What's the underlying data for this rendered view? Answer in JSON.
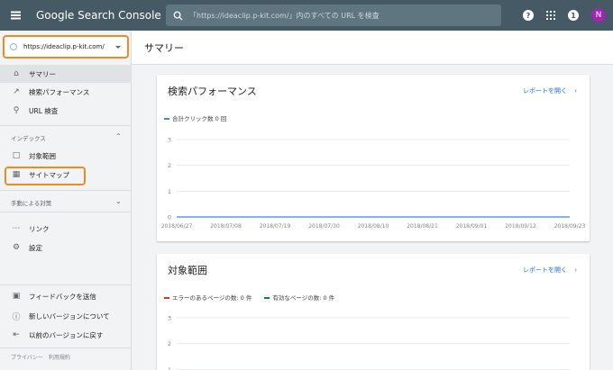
{
  "topbar": {
    "app_title": "Google Search Console",
    "search_placeholder": "「https://ideaclip.p-kit.com/」内のすべての URL を検査",
    "help_icon": "help-icon",
    "apps_icon": "apps-icon",
    "notification_count": "1",
    "avatar_letter": "N",
    "colors": {
      "bar": "#455a64",
      "avatar": "#9c27b0"
    }
  },
  "sidebar": {
    "property": "https://ideaclip.p-kit.com/",
    "items": [
      {
        "label": "サマリー",
        "icon": "home-icon"
      },
      {
        "label": "検索パフォーマンス",
        "icon": "trending-icon"
      },
      {
        "label": "URL 検査",
        "icon": "search-icon"
      }
    ],
    "index_section": "インデックス",
    "index_items": [
      {
        "label": "対象範囲",
        "icon": "pages-icon"
      },
      {
        "label": "サイトマップ",
        "icon": "sitemap-icon"
      }
    ],
    "manual_section": "手動による対策",
    "other_items": [
      {
        "label": "リンク",
        "icon": "links-icon"
      },
      {
        "label": "設定",
        "icon": "settings-icon"
      }
    ],
    "bottom_items": [
      {
        "label": "フィードバックを送信",
        "icon": "feedback-icon"
      },
      {
        "label": "新しいバージョンについて",
        "icon": "info-icon"
      },
      {
        "label": "以前のバージョンに戻す",
        "icon": "exit-icon"
      }
    ],
    "footer": {
      "privacy": "プライバシー",
      "terms": "利用規約"
    },
    "highlight_color": "#f08a24"
  },
  "main": {
    "page_title": "サマリー",
    "cards": [
      {
        "title": "検索パフォーマンス",
        "link": "レポートを開く",
        "legend": [
          {
            "label": "合計クリック数 0 回",
            "color": "#4285f4"
          }
        ]
      },
      {
        "title": "対象範囲",
        "link": "レポートを開く",
        "legend": [
          {
            "label": "エラーのあるページの数: 0 件",
            "color": "#d93025"
          },
          {
            "label": "有効なページの数: 0 件",
            "color": "#188038"
          }
        ]
      }
    ]
  },
  "chart_data": [
    {
      "type": "line",
      "x": [
        "2018/06/27",
        "2018/07/08",
        "2018/07/19",
        "2018/07/30",
        "2018/08/10",
        "2018/08/21",
        "2018/09/01",
        "2018/09/12",
        "2018/09/23"
      ],
      "series": [
        {
          "name": "合計クリック数 0 回",
          "values": [
            0,
            0,
            0,
            0,
            0,
            0,
            0,
            0,
            0
          ],
          "color": "#4285f4"
        }
      ],
      "y_ticks": [
        "3",
        "2",
        "1",
        "0"
      ],
      "ylim": [
        0,
        3
      ],
      "grid": true
    },
    {
      "type": "line",
      "x": [],
      "series": [
        {
          "name": "エラーのあるページの数: 0 件",
          "values": [],
          "color": "#d93025"
        },
        {
          "name": "有効なページの数: 0 件",
          "values": [],
          "color": "#188038"
        }
      ],
      "y_ticks": [
        "3",
        "2",
        "1"
      ],
      "ylim": [
        0,
        3
      ],
      "grid": true
    }
  ]
}
